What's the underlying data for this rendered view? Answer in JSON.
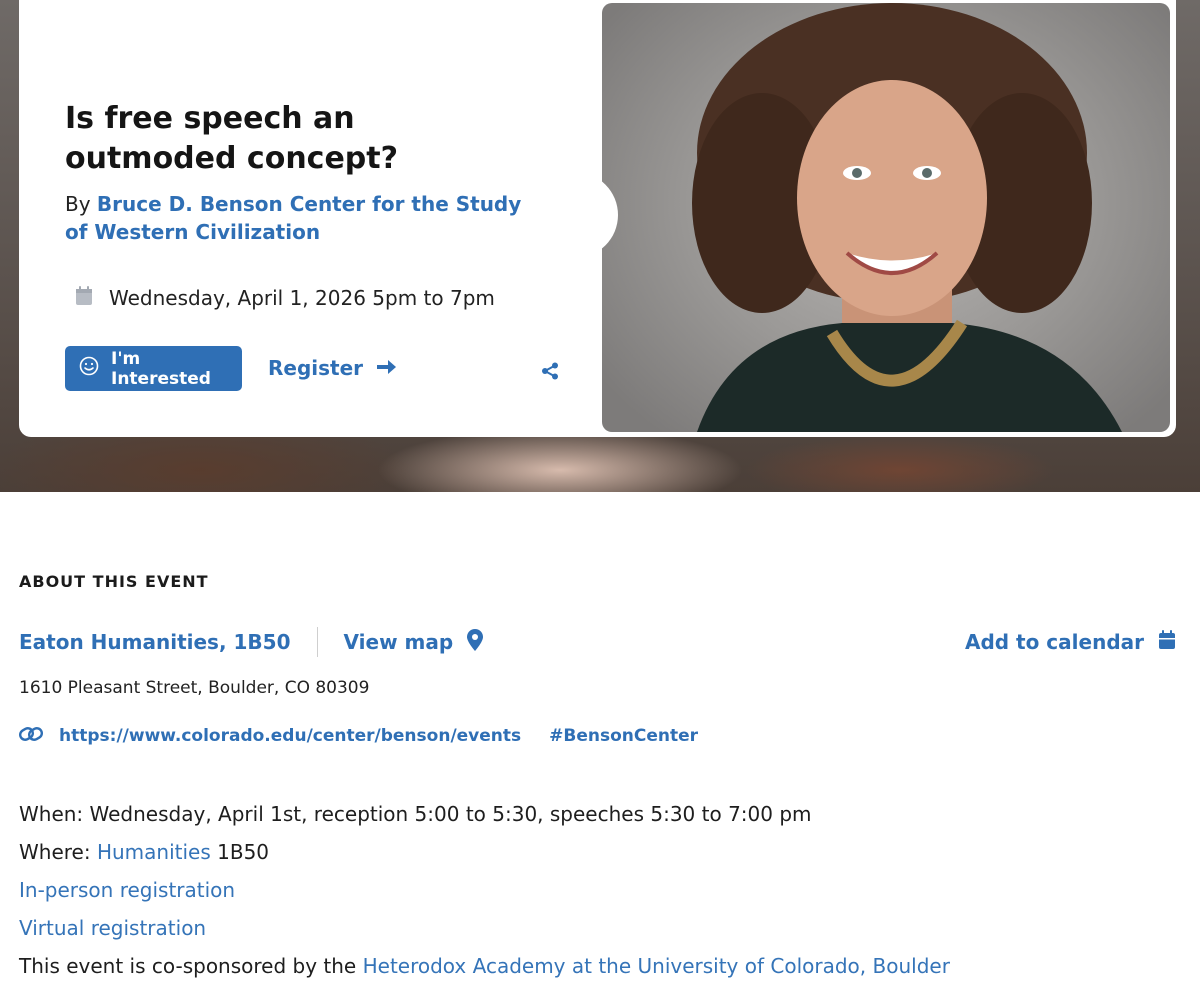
{
  "event": {
    "title": "Is free speech an outmoded concept?",
    "by_prefix": "By",
    "organizer": "Bruce D. Benson Center for the Study of Western Civilization",
    "datetime": "Wednesday, April 1, 2026 5pm to 7pm",
    "interested_label": "I'm Interested",
    "register_label": "Register"
  },
  "about": {
    "heading": "ABOUT THIS EVENT",
    "location_name": "Eaton Humanities, 1B50",
    "view_map_label": "View map",
    "add_calendar_label": "Add to calendar",
    "address": "1610 Pleasant Street, Boulder, CO 80309",
    "url": "https://www.colorado.edu/center/benson/events",
    "hashtag": "#BensonCenter"
  },
  "description": {
    "when": "When: Wednesday, April 1st, reception 5:00 to 5:30, speeches 5:30 to 7:00 pm",
    "where_prefix": "Where: ",
    "where_link": "Humanities",
    "where_suffix": " 1B50",
    "inperson_link": "In-person registration",
    "virtual_link": "Virtual registration",
    "cosponsor_prefix": "This event is co-sponsored by the ",
    "cosponsor_link": "Heterodox Academy at the University of Colorado, Boulder"
  },
  "icons": {
    "calendar": "calendar-icon",
    "smile": "smile-icon",
    "arrow": "arrow-right-icon",
    "share": "share-icon",
    "map_pin": "map-pin-icon",
    "link": "link-icon"
  },
  "colors": {
    "accent": "#2f6fb5",
    "text": "#1b1b1b"
  }
}
